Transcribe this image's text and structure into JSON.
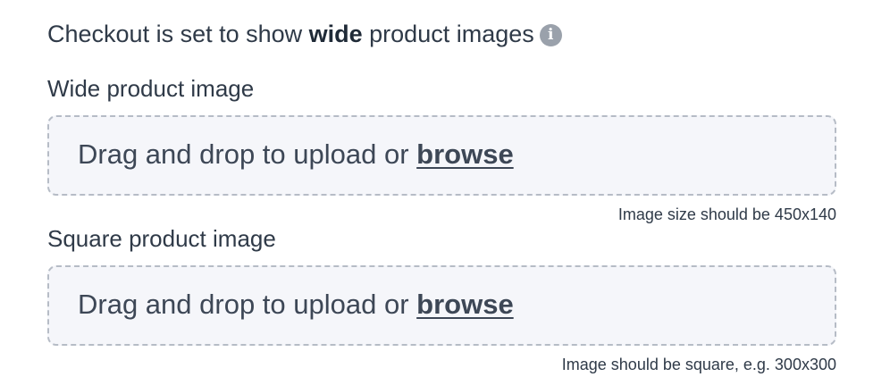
{
  "header": {
    "prefix": "Checkout is set to show ",
    "emphasis": "wide",
    "suffix": " product images",
    "info_icon": "info-icon",
    "info_glyph": "i"
  },
  "wide_image": {
    "label": "Wide product image",
    "drop_text": "Drag and drop to upload or ",
    "browse_label": "browse",
    "hint": "Image size should be 450x140"
  },
  "square_image": {
    "label": "Square product image",
    "drop_text": "Drag and drop to upload or ",
    "browse_label": "browse",
    "hint": "Image should be square, e.g. 300x300"
  },
  "colors": {
    "text": "#2f3a48",
    "dropzone_bg": "#f5f6fa",
    "dropzone_border": "#b6bcc6",
    "info_icon": "#9aa1ab"
  }
}
